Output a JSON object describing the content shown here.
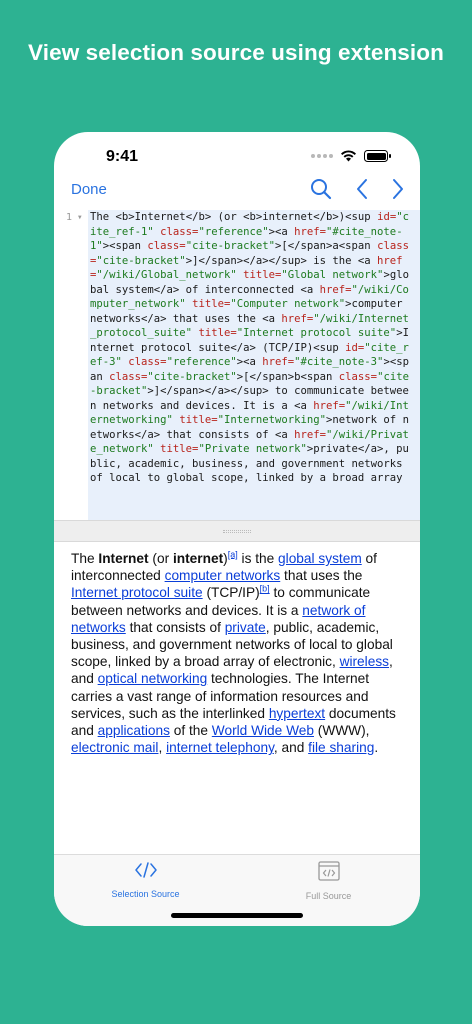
{
  "headline": "View selection source using extension",
  "status": {
    "time": "9:41"
  },
  "nav": {
    "done_label": "Done",
    "icons": [
      "search-icon",
      "chevron-left-icon",
      "chevron-right-icon"
    ]
  },
  "editor": {
    "line_number": "1",
    "segments": [
      {
        "c": "t",
        "s": "The "
      },
      {
        "c": "t",
        "s": "<b>"
      },
      {
        "c": "t",
        "s": "Internet"
      },
      {
        "c": "t",
        "s": "</b>"
      },
      {
        "c": "t",
        "s": " (or "
      },
      {
        "c": "t",
        "s": "<b>"
      },
      {
        "c": "t",
        "s": "internet"
      },
      {
        "c": "t",
        "s": "</b>"
      },
      {
        "c": "t",
        "s": ")"
      },
      {
        "c": "t",
        "s": "<sup "
      },
      {
        "c": "a",
        "s": "id="
      },
      {
        "c": "v",
        "s": "\"cite_ref-1\""
      },
      {
        "c": "t",
        "s": " "
      },
      {
        "c": "a",
        "s": "class="
      },
      {
        "c": "v",
        "s": "\"reference\""
      },
      {
        "c": "t",
        "s": "><a "
      },
      {
        "c": "a",
        "s": "href="
      },
      {
        "c": "v",
        "s": "\"#cite_note-1\""
      },
      {
        "c": "t",
        "s": "><span "
      },
      {
        "c": "a",
        "s": "class="
      },
      {
        "c": "v",
        "s": "\"cite-bracket\""
      },
      {
        "c": "t",
        "s": ">"
      },
      {
        "c": "t",
        "s": "[</span>a<span "
      },
      {
        "c": "a",
        "s": "class="
      },
      {
        "c": "v",
        "s": "\"cite-bracket\""
      },
      {
        "c": "t",
        "s": ">]</span></a>"
      },
      {
        "c": "t",
        "s": "</sup> is the "
      },
      {
        "c": "t",
        "s": "<a "
      },
      {
        "c": "a",
        "s": "href="
      },
      {
        "c": "v",
        "s": "\"/wiki/Global_network\""
      },
      {
        "c": "t",
        "s": " "
      },
      {
        "c": "a",
        "s": "title="
      },
      {
        "c": "v",
        "s": "\"Global network\""
      },
      {
        "c": "t",
        "s": ">global system</a> of interconnected "
      },
      {
        "c": "t",
        "s": "<a "
      },
      {
        "c": "a",
        "s": "href="
      },
      {
        "c": "v",
        "s": "\"/wiki/Computer_network\""
      },
      {
        "c": "t",
        "s": " "
      },
      {
        "c": "a",
        "s": "title="
      },
      {
        "c": "v",
        "s": "\"Computer network\""
      },
      {
        "c": "t",
        "s": ">computer networks</a> that uses the "
      },
      {
        "c": "t",
        "s": "<a "
      },
      {
        "c": "a",
        "s": "href="
      },
      {
        "c": "v",
        "s": "\"/wiki/Internet_protocol_suite\""
      },
      {
        "c": "t",
        "s": " "
      },
      {
        "c": "a",
        "s": "title="
      },
      {
        "c": "v",
        "s": "\"Internet protocol suite\""
      },
      {
        "c": "t",
        "s": ">Internet protocol suite</a> (TCP/IP)"
      },
      {
        "c": "t",
        "s": "<sup "
      },
      {
        "c": "a",
        "s": "id="
      },
      {
        "c": "v",
        "s": "\"cite_ref-3\""
      },
      {
        "c": "t",
        "s": " "
      },
      {
        "c": "a",
        "s": "class="
      },
      {
        "c": "v",
        "s": "\"reference\""
      },
      {
        "c": "t",
        "s": "><a "
      },
      {
        "c": "a",
        "s": "href="
      },
      {
        "c": "v",
        "s": "\"#cite_note-3\""
      },
      {
        "c": "t",
        "s": "><span "
      },
      {
        "c": "a",
        "s": "class="
      },
      {
        "c": "v",
        "s": "\"cite-bracket\""
      },
      {
        "c": "t",
        "s": ">[</span>b<span "
      },
      {
        "c": "a",
        "s": "class="
      },
      {
        "c": "v",
        "s": "\"cite-bracket\""
      },
      {
        "c": "t",
        "s": ">]</span></a></sup> to communicate between networks and devices. It is a "
      },
      {
        "c": "t",
        "s": "<a "
      },
      {
        "c": "a",
        "s": "href="
      },
      {
        "c": "v",
        "s": "\"/wiki/Internetworking\""
      },
      {
        "c": "t",
        "s": " "
      },
      {
        "c": "a",
        "s": "title="
      },
      {
        "c": "v",
        "s": "\"Internetworking\""
      },
      {
        "c": "t",
        "s": ">network of networks</a> that consists of "
      },
      {
        "c": "t",
        "s": "<a "
      },
      {
        "c": "a",
        "s": "href="
      },
      {
        "c": "v",
        "s": "\"/wiki/Private_network\""
      },
      {
        "c": "t",
        "s": " "
      },
      {
        "c": "a",
        "s": "title="
      },
      {
        "c": "v",
        "s": "\"Private network\""
      },
      {
        "c": "t",
        "s": ">private</a>, public, academic, business, and government networks of local to global scope, linked by a broad array"
      }
    ]
  },
  "preview": {
    "parts": [
      {
        "k": "text",
        "s": "The "
      },
      {
        "k": "bold",
        "s": "Internet"
      },
      {
        "k": "text",
        "s": " (or "
      },
      {
        "k": "bold",
        "s": "internet"
      },
      {
        "k": "text",
        "s": ")"
      },
      {
        "k": "sup",
        "s": "[a]"
      },
      {
        "k": "text",
        "s": " is the "
      },
      {
        "k": "link",
        "s": "global system"
      },
      {
        "k": "text",
        "s": " of interconnected "
      },
      {
        "k": "link",
        "s": "computer networks"
      },
      {
        "k": "text",
        "s": " that uses the "
      },
      {
        "k": "link",
        "s": "Internet protocol suite"
      },
      {
        "k": "text",
        "s": " (TCP/IP)"
      },
      {
        "k": "sup",
        "s": "[b]"
      },
      {
        "k": "text",
        "s": " to communicate between networks and devices. It is a "
      },
      {
        "k": "link",
        "s": "network of networks"
      },
      {
        "k": "text",
        "s": " that consists of "
      },
      {
        "k": "link",
        "s": "private"
      },
      {
        "k": "text",
        "s": ", public, academic, business, and government networks of local to global scope, linked by a broad array of electronic, "
      },
      {
        "k": "link",
        "s": "wireless"
      },
      {
        "k": "text",
        "s": ", and "
      },
      {
        "k": "link",
        "s": "optical networking"
      },
      {
        "k": "text",
        "s": " technologies. The Internet carries a vast range of information resources and services, such as the interlinked "
      },
      {
        "k": "link",
        "s": "hypertext"
      },
      {
        "k": "text",
        "s": " documents and "
      },
      {
        "k": "link",
        "s": "applications"
      },
      {
        "k": "text",
        "s": " of the "
      },
      {
        "k": "link",
        "s": "World Wide Web"
      },
      {
        "k": "text",
        "s": " (WWW), "
      },
      {
        "k": "link",
        "s": "electronic mail"
      },
      {
        "k": "text",
        "s": ", "
      },
      {
        "k": "link",
        "s": "internet telephony"
      },
      {
        "k": "text",
        "s": ", and "
      },
      {
        "k": "link",
        "s": "file sharing"
      },
      {
        "k": "text",
        "s": "."
      }
    ]
  },
  "tabs": [
    {
      "label": "Selection Source",
      "icon": "code-brackets-icon",
      "selected": true
    },
    {
      "label": "Full Source",
      "icon": "code-window-icon",
      "selected": false
    }
  ],
  "colors": {
    "background": "#2db292",
    "accent": "#2a73e0",
    "link": "#0a3ed8",
    "code_bg": "#e8f0fb"
  }
}
